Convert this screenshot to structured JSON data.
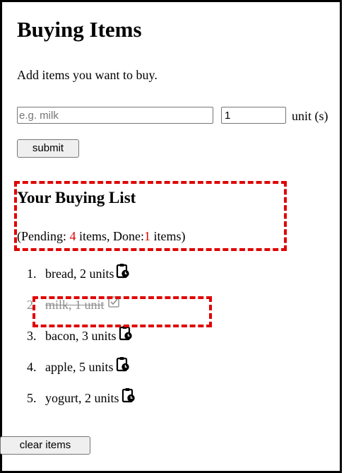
{
  "app": {
    "title": "Buying Items",
    "intro": "Add items you want to buy."
  },
  "form": {
    "item_placeholder": "e.g. milk",
    "quantity_value": "1",
    "unit_label": "unit (s)",
    "submit_label": "submit"
  },
  "list_section": {
    "heading": "Your Buying List",
    "status": {
      "prefix": "(Pending: ",
      "pending_count": "4",
      "middle": " items, Done:",
      "done_count": "1",
      "suffix": " items)"
    }
  },
  "items": [
    {
      "num": "1.",
      "text": "bread, 2 units",
      "done": false,
      "icon": "clipboard-clock-icon"
    },
    {
      "num": "2.",
      "text": "milk, 1 unit",
      "done": true,
      "icon": "checkbox-checked-icon"
    },
    {
      "num": "3.",
      "text": "bacon, 3 units",
      "done": false,
      "icon": "clipboard-clock-icon"
    },
    {
      "num": "4.",
      "text": "apple, 5 units",
      "done": false,
      "icon": "clipboard-clock-icon"
    },
    {
      "num": "5.",
      "text": "yogurt, 2 units",
      "done": false,
      "icon": "clipboard-clock-icon"
    }
  ],
  "footer": {
    "clear_label": "clear items"
  },
  "colors": {
    "accent_red": "#e00000",
    "done_gray": "#8c8c8c"
  }
}
